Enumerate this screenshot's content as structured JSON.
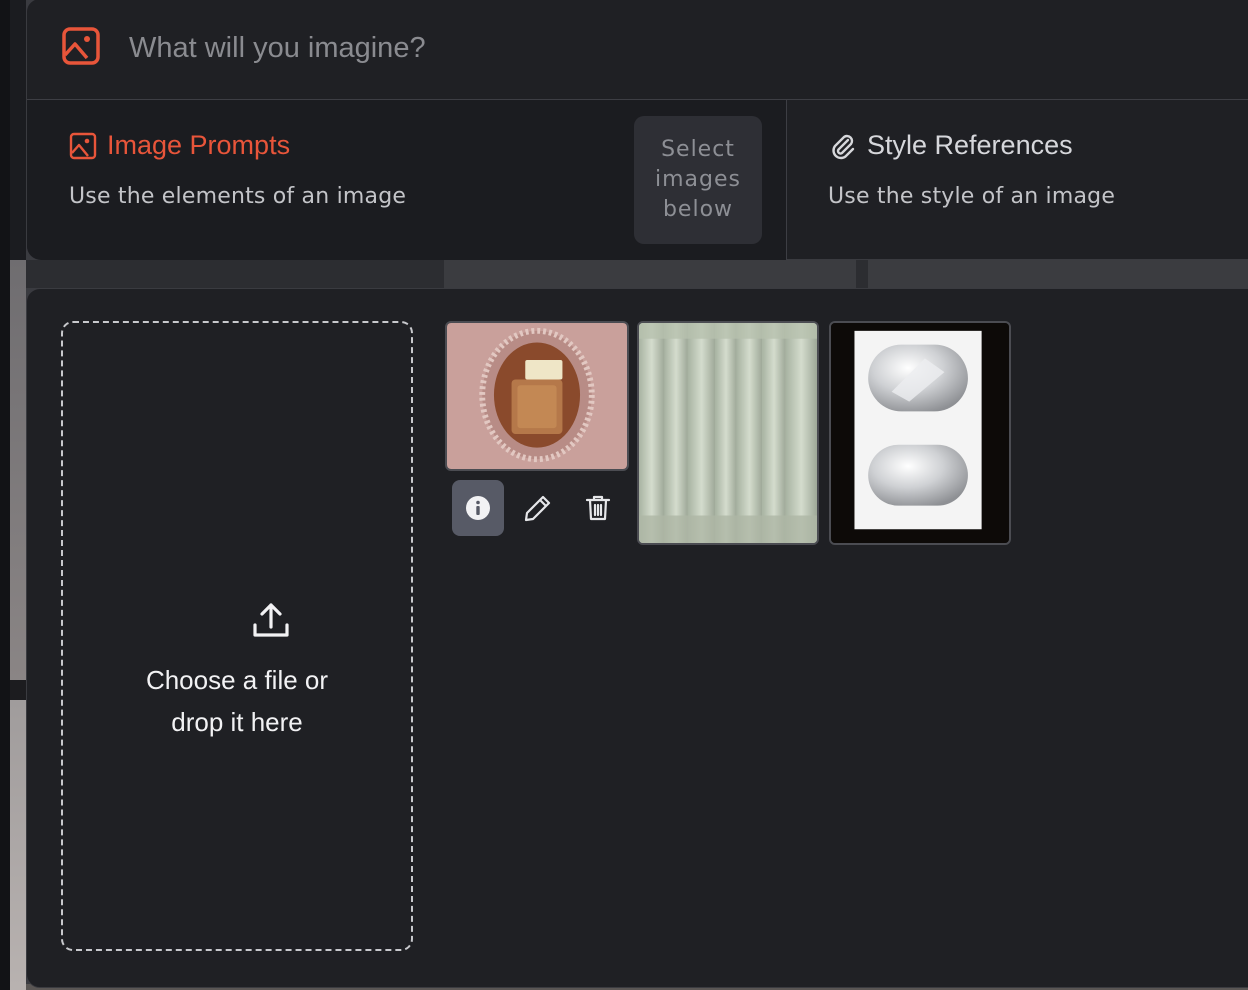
{
  "prompt": {
    "placeholder": "What will you imagine?",
    "icon": "image-icon",
    "accent_color": "#e8553a"
  },
  "references": {
    "image_prompts": {
      "title": "Image Prompts",
      "description": "Use the elements of an image",
      "icon": "image-icon",
      "selected": true
    },
    "select_button": {
      "label": "Select\nimages\nbelow"
    },
    "style_references": {
      "title": "Style References",
      "description": "Use the style of an image",
      "icon": "paperclip-icon"
    }
  },
  "upload": {
    "icon": "upload-icon",
    "line1": "Choose a file or",
    "line2": "drop it here"
  },
  "gallery": {
    "images": [
      {
        "name": "perfume-bottle-oval-frame",
        "description": "amber perfume bottle in pink embossed oval frame"
      },
      {
        "name": "pleated-sage-fabric",
        "description": "pleated sage green fabric"
      },
      {
        "name": "silver-blister-pack",
        "description": "silver metallic blister shapes on white"
      }
    ],
    "actions": [
      {
        "name": "info-icon",
        "active": true
      },
      {
        "name": "pencil-icon",
        "active": false
      },
      {
        "name": "trash-icon",
        "active": false
      }
    ]
  }
}
